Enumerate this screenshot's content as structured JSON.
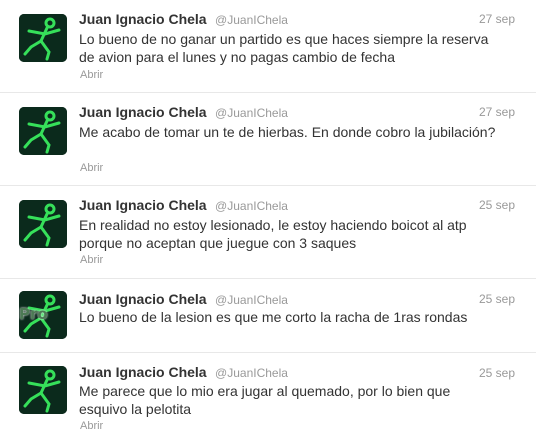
{
  "tweets": [
    {
      "name": "Juan Ignacio Chela",
      "handle": "@JuanIChela",
      "date": "27 sep",
      "text": "Lo bueno de no ganar un partido es que haces siempre la reserva de avion para el lunes y no pagas cambio de fecha",
      "action": "Abrir"
    },
    {
      "name": "Juan Ignacio Chela",
      "handle": "@JuanIChela",
      "date": "27 sep",
      "text": "Me acabo de tomar un te de hierbas. En donde cobro la jubilación?",
      "action": "Abrir"
    },
    {
      "name": "Juan Ignacio Chela",
      "handle": "@JuanIChela",
      "date": "25 sep",
      "text": "En realidad no estoy lesionado, le estoy haciendo boicot al atp porque no aceptan que juegue con 3 saques",
      "action": "Abrir"
    },
    {
      "name": "Juan Ignacio Chela",
      "handle": "@JuanIChela",
      "date": "25 sep",
      "text": "Lo bueno de la lesion es que me corto la racha de 1ras rondas",
      "avatar_overlay": "Pro"
    },
    {
      "name": "Juan Ignacio Chela",
      "handle": "@JuanIChela",
      "date": "25 sep",
      "text": "Me parece que lo mio era jugar al quemado, por lo bien que esquivo la pelotita",
      "action": "Abrir"
    }
  ],
  "colors": {
    "name": "#333333",
    "muted": "#999999",
    "divider": "#e8e8e8",
    "avatar_green": "#2ecc40"
  },
  "icons": {
    "avatar": "green-stick-figure-avatar"
  }
}
